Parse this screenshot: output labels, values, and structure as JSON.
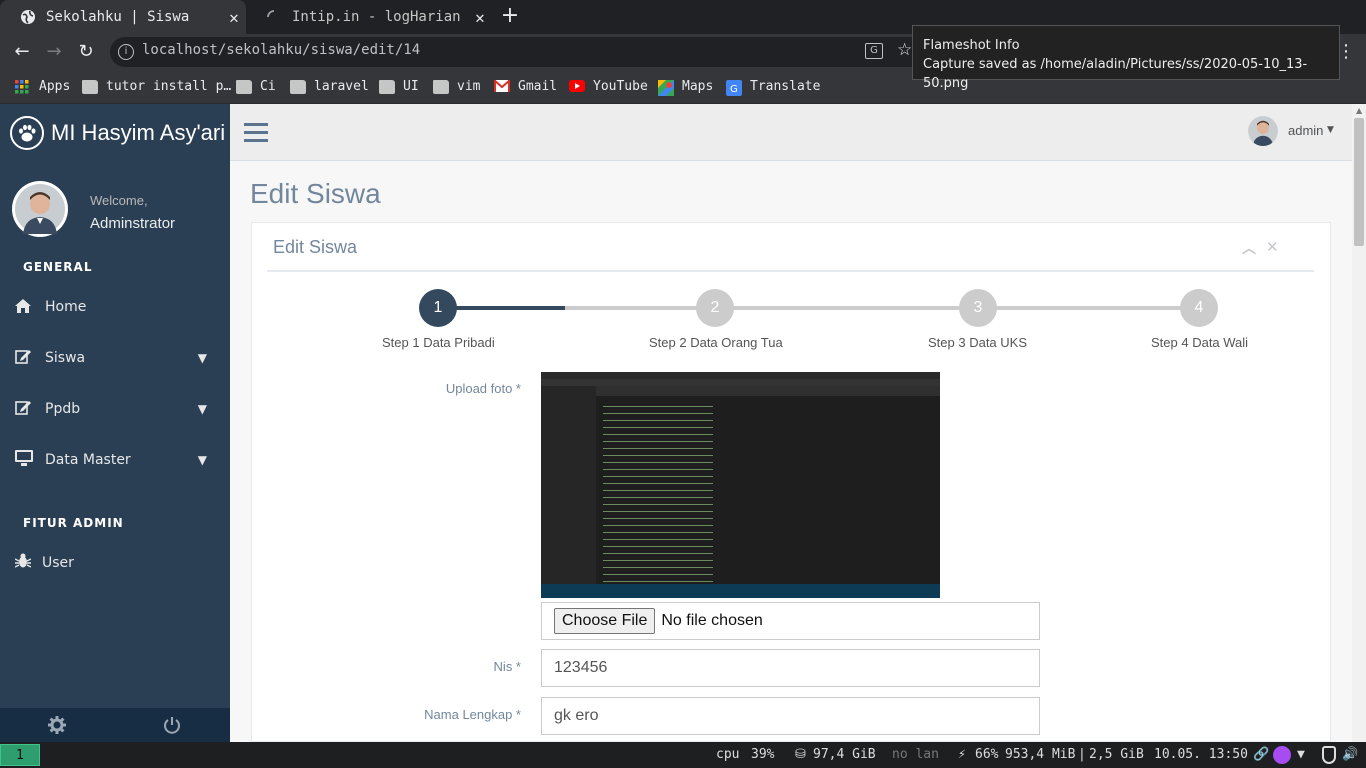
{
  "browser": {
    "tabs": [
      {
        "title": "Sekolahku | Siswa",
        "active": true
      },
      {
        "title": "Intip.in - logHarian",
        "active": false
      }
    ],
    "url": "localhost/sekolahku/siswa/edit/14",
    "bookmarks": [
      "Apps",
      "tutor install p…",
      "Ci",
      "laravel",
      "UI",
      "vim",
      "Gmail",
      "YouTube",
      "Maps",
      "Translate"
    ]
  },
  "toast": {
    "title": "Flameshot Info",
    "message": "Capture saved as /home/aladin/Pictures/ss/2020-05-10_13-50.png"
  },
  "sidebar": {
    "brand": "MI Hasyim Asy'ari",
    "welcome": "Welcome,",
    "user_name": "Adminstrator",
    "section_general": "GENERAL",
    "menu": [
      {
        "label": "Home",
        "icon": "home-icon"
      },
      {
        "label": "Siswa",
        "icon": "edit-icon"
      },
      {
        "label": "Ppdb",
        "icon": "edit-icon"
      },
      {
        "label": "Data Master",
        "icon": "desktop-icon"
      }
    ],
    "section_admin": "FITUR ADMIN",
    "admin_menu": [
      {
        "label": "User",
        "icon": "bug-icon"
      }
    ]
  },
  "topnav": {
    "user": "admin"
  },
  "page": {
    "title": "Edit Siswa",
    "panel_title": "Edit Siswa",
    "steps": [
      {
        "num": "1",
        "label": "Step 1 Data Pribadi",
        "active": true
      },
      {
        "num": "2",
        "label": "Step 2 Data Orang Tua",
        "active": false
      },
      {
        "num": "3",
        "label": "Step 3 Data UKS",
        "active": false
      },
      {
        "num": "4",
        "label": "Step 4 Data Wali",
        "active": false
      }
    ],
    "form": {
      "upload_label": "Upload foto *",
      "file_button": "Choose File",
      "file_status": "No file chosen",
      "nis_label": "Nis *",
      "nis_value": "123456",
      "nama_label": "Nama Lengkap *",
      "nama_value": "gk ero"
    }
  },
  "statusbar": {
    "workspace": "1",
    "cpu_label": "cpu",
    "cpu": "39%",
    "disk": "97,4 GiB",
    "lan": "no lan",
    "battery": "66%",
    "mem1": "953,4 MiB",
    "mem2": "2,5 GiB",
    "datetime": "10.05. 13:50"
  },
  "colors": {
    "sidebar": "#2a3f54",
    "step_active": "#34495e",
    "step_inactive": "#cccccc"
  }
}
